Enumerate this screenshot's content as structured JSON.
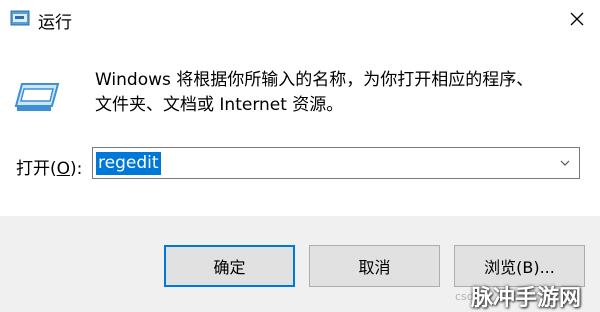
{
  "window": {
    "title": "运行"
  },
  "description": {
    "line1": "Windows 将根据你所输入的名称，为你打开相应的程序、",
    "line2": "文件夹、文档或 Internet 资源。"
  },
  "open_field": {
    "label_prefix": "打开(",
    "label_accel": "O",
    "label_suffix": "):",
    "value": "regedit"
  },
  "buttons": {
    "ok": "确定",
    "cancel": "取消",
    "browse": "浏览(B)..."
  },
  "watermark": {
    "text": "脉冲手游网",
    "small": "csd"
  },
  "icons": {
    "app": "run-dialog-icon",
    "close": "close-icon",
    "run": "run-program-icon",
    "dropdown": "chevron-down-icon"
  },
  "colors": {
    "selection": "#0078d7",
    "footer": "#f0f0f0",
    "default_button_border": "#0078d7"
  }
}
